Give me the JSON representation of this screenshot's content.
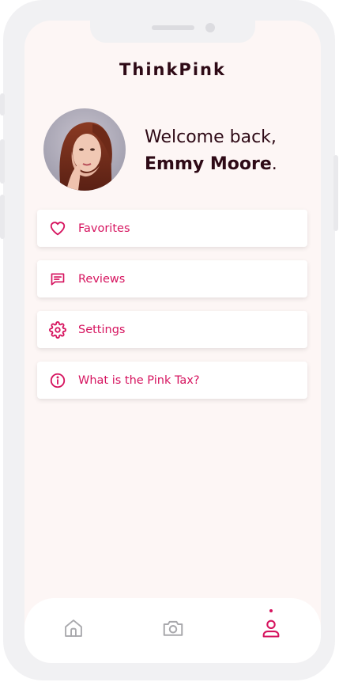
{
  "app": {
    "title": "ThinkPink"
  },
  "profile": {
    "greeting": "Welcome back,",
    "name": "Emmy Moore",
    "name_suffix": "."
  },
  "menu": [
    {
      "label": "Favorites",
      "icon": "heart-icon"
    },
    {
      "label": "Reviews",
      "icon": "chat-icon"
    },
    {
      "label": "Settings",
      "icon": "gear-icon"
    },
    {
      "label": "What is the Pink Tax?",
      "icon": "info-icon"
    }
  ],
  "tabbar": {
    "tabs": [
      {
        "icon": "home-icon",
        "active": false
      },
      {
        "icon": "camera-icon",
        "active": false
      },
      {
        "icon": "user-icon",
        "active": true
      }
    ]
  },
  "colors": {
    "accent": "#d6145f",
    "title": "#2e0a16",
    "background": "#fdf6f5",
    "inactive_icon": "#a8a8ac"
  }
}
